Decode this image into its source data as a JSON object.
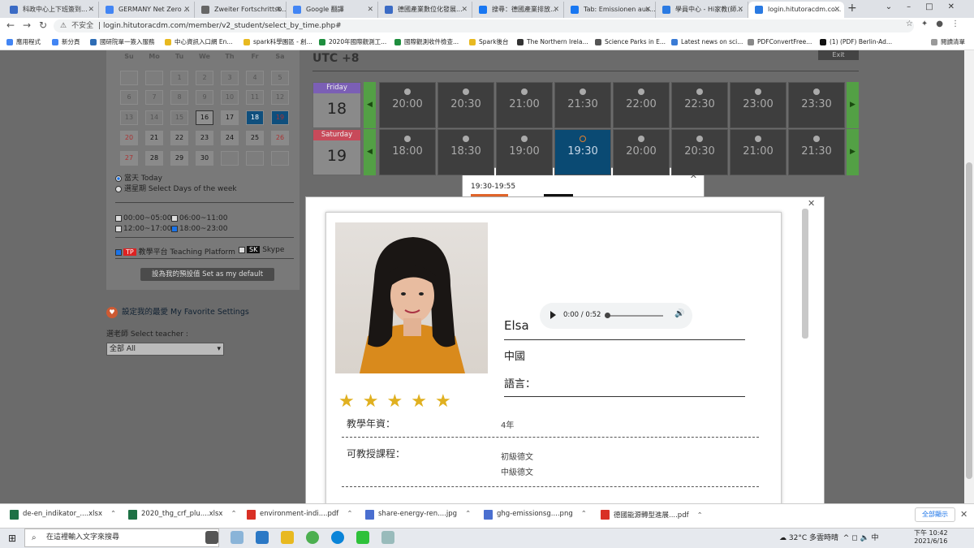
{
  "browser": {
    "tabs": [
      {
        "title": "科政中心上下班簽到...",
        "color": "#3b6bc5"
      },
      {
        "title": "GERMANY Net Zero ...",
        "color": "#4285f4"
      },
      {
        "title": "Zweiter Fortschrittsb...",
        "color": "#666666"
      },
      {
        "title": "Google 翻譯",
        "color": "#4285f4"
      },
      {
        "title": "德國產業數位化發展...",
        "color": "#3b6bc5"
      },
      {
        "title": "搜尋：德國產業排放...",
        "color": "#1877f2"
      },
      {
        "title": "Tab: Emissionen aus...",
        "color": "#1877f2"
      },
      {
        "title": "學員中心 - Hi家教(師...",
        "color": "#2a7ae2"
      },
      {
        "title": "login.hitutoracdm.co...",
        "color": "#2a7ae2"
      }
    ],
    "new_tab": "+",
    "url_prefix": "不安全",
    "url": "login.hitutoracdm.com/member/v2_student/select_by_time.php#",
    "bookmarks": [
      {
        "label": "應用程式",
        "color": "#4285f4"
      },
      {
        "label": "新分頁",
        "color": "#4285f4"
      },
      {
        "label": "國研院單一簽入服務",
        "color": "#2d6cb5"
      },
      {
        "label": "中心資訊入口網 En...",
        "color": "#e8b920"
      },
      {
        "label": "spark科學園區 - 創...",
        "color": "#e8b920"
      },
      {
        "label": "2020年國際觀測工...",
        "color": "#1e8e3e"
      },
      {
        "label": "國際觀測收件檢查...",
        "color": "#1e8e3e"
      },
      {
        "label": "Spark後台",
        "color": "#e8b920"
      },
      {
        "label": "The Northern Irela...",
        "color": "#333333"
      },
      {
        "label": "Science Parks in E...",
        "color": "#555555"
      },
      {
        "label": "Latest news on sci...",
        "color": "#3a7bd5"
      },
      {
        "label": "PDFConvertFree...",
        "color": "#888888"
      },
      {
        "label": "(1) (PDF) Berlin-Ad...",
        "color": "#111111"
      }
    ],
    "reading_list": "閱讀清單"
  },
  "calendar": {
    "weekdays": [
      "Su",
      "Mo",
      "Tu",
      "We",
      "Th",
      "Fr",
      "Sa"
    ],
    "rows": [
      [
        "",
        "",
        "1",
        "2",
        "3",
        "4",
        "5"
      ],
      [
        "6",
        "7",
        "8",
        "9",
        "10",
        "11",
        "12"
      ],
      [
        "13",
        "14",
        "15",
        "16",
        "17",
        "18",
        "19"
      ],
      [
        "20",
        "21",
        "22",
        "23",
        "24",
        "25",
        "26"
      ],
      [
        "27",
        "28",
        "29",
        "30",
        "",
        "",
        ""
      ]
    ],
    "today": "16",
    "selected": [
      "18",
      "19"
    ]
  },
  "filters": {
    "today_option": "當天 Today",
    "week_option": "選星期 Select Days of the week",
    "time_ranges": [
      "00:00~05:00",
      "06:00~11:00",
      "12:00~17:00",
      "18:00~23:00"
    ],
    "platform_badge": "TP",
    "platform_label": "教學平台 Teaching Platform",
    "skype_badge": "SK",
    "skype_label": "Skype",
    "default_button": "設為我的預設值 Set as my default"
  },
  "favorites": {
    "title": "設定我的最愛 My Favorite Settings",
    "teacher_label": "選老師 Select teacher :",
    "teacher_value": "全部 All"
  },
  "schedule": {
    "timezone": "UTC +8",
    "exit": "Exit",
    "days": [
      {
        "name": "Friday",
        "num": "18",
        "color": "#7b5fb5",
        "slots": [
          "20:00",
          "20:30",
          "21:00",
          "21:30",
          "22:00",
          "22:30",
          "23:00",
          "23:30"
        ],
        "selected": -1
      },
      {
        "name": "Saturday",
        "num": "19",
        "color": "#c84a5a",
        "slots": [
          "18:00",
          "18:30",
          "19:00",
          "19:30",
          "20:00",
          "20:30",
          "21:00",
          "21:30"
        ],
        "selected": 3
      }
    ]
  },
  "popup": {
    "time": "19:30-19:55"
  },
  "teacher": {
    "name": "Elsa",
    "country": "中國",
    "language_label": "語言：",
    "rating": 5,
    "audio_time": "0:00 / 0:52",
    "experience_label": "教學年資：",
    "experience_value": "4年",
    "courses_label": "可教授課程：",
    "courses": [
      "初級德文",
      "中級德文"
    ]
  },
  "downloads": [
    {
      "name": "de-en_indikator_....xlsx",
      "color": "#1e7145"
    },
    {
      "name": "2020_thg_crf_plu....xlsx",
      "color": "#1e7145"
    },
    {
      "name": "environment-indi....pdf",
      "color": "#d93025"
    },
    {
      "name": "share-energy-ren....jpg",
      "color": "#4a6fd0"
    },
    {
      "name": "ghg-emissionsg....png",
      "color": "#4a6fd0"
    },
    {
      "name": "德國能源轉型進展....pdf",
      "color": "#d93025"
    }
  ],
  "show_all": "全部顯示",
  "taskbar": {
    "search_placeholder": "在這裡輸入文字來搜尋",
    "weather": "32°C 多雲時晴",
    "ime": "中",
    "time": "下午 10:42",
    "date": "2021/6/16"
  }
}
